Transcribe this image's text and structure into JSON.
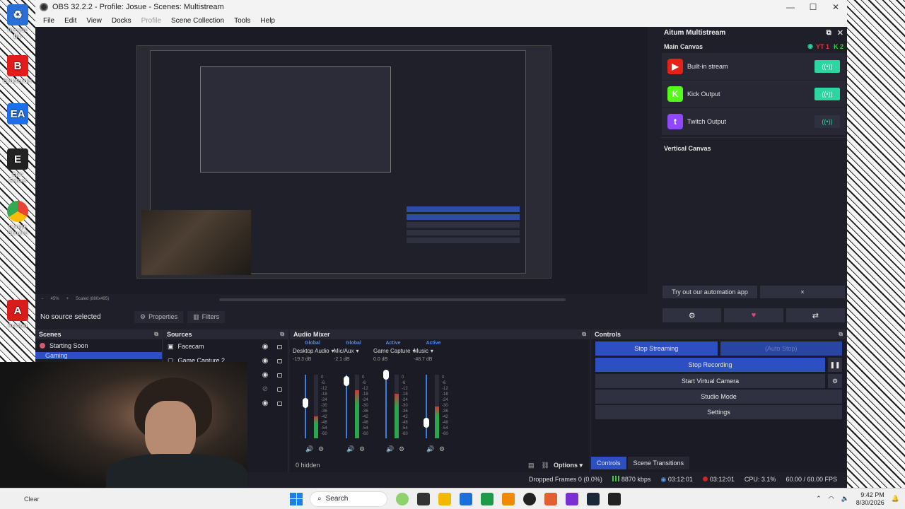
{
  "window": {
    "title": "OBS 32.2.2 - Profile: Josue - Scenes: Multistream",
    "menu": [
      "File",
      "Edit",
      "View",
      "Docks",
      "Profile",
      "Scene Collection",
      "Tools",
      "Help"
    ]
  },
  "desktop_icons": [
    "Recycle Bin",
    "Bitdefender",
    "EA",
    "Epic Games",
    "Google Chrome",
    "Acrobat"
  ],
  "preview": {
    "zoom_label": "45%",
    "scaled_label": "Scaled (880x495)"
  },
  "source_toolbar": {
    "status": "No source selected",
    "properties": "Properties",
    "filters": "Filters"
  },
  "multistream": {
    "title": "Aitum Multistream",
    "main_canvas": "Main Canvas",
    "yt_tag": "YT 1",
    "k_tag": "K 2",
    "outputs": [
      {
        "name": "Built-in stream",
        "state": "on",
        "color": "#e62117",
        "glyph": "▶"
      },
      {
        "name": "Kick Output",
        "state": "on",
        "color": "#53fc18",
        "glyph": "K"
      },
      {
        "name": "Twitch Output",
        "state": "off",
        "color": "#9146ff",
        "glyph": "t"
      }
    ],
    "vertical_canvas": "Vertical Canvas",
    "automation": "Try out our automation app",
    "close_symbol": "×"
  },
  "scenes": {
    "title": "Scenes",
    "items": [
      "Starting Soon",
      "Gaming"
    ]
  },
  "sources": {
    "title": "Sources",
    "items": [
      "Facecam",
      "Game Capture 2"
    ]
  },
  "mixer": {
    "title": "Audio Mixer",
    "channels": [
      {
        "tag": "Global",
        "name": "Desktop Audio",
        "db": "-19.3 dB",
        "level": 0.35,
        "vol": 0.55
      },
      {
        "tag": "Global",
        "name": "Mic/Aux",
        "db": "-2.1 dB",
        "level": 0.75,
        "vol": 0.9
      },
      {
        "tag": "Active",
        "name": "Game Capture",
        "db": "0.0 dB",
        "level": 0.7,
        "vol": 1.0
      },
      {
        "tag": "Active",
        "name": "Music",
        "db": "-48.7 dB",
        "level": 0.5,
        "vol": 0.25
      }
    ],
    "scale": [
      "0",
      "-6",
      "-12",
      "-18",
      "-24",
      "-30",
      "-36",
      "-42",
      "-48",
      "-54",
      "-60"
    ],
    "hidden": "0 hidden",
    "options": "Options"
  },
  "controls": {
    "title": "Controls",
    "stop_streaming": "Stop Streaming",
    "auto_stop": "(Auto Stop)",
    "stop_recording": "Stop Recording",
    "start_virtual_camera": "Start Virtual Camera",
    "studio_mode": "Studio Mode",
    "settings": "Settings",
    "tab_controls": "Controls",
    "tab_transitions": "Scene Transitions"
  },
  "stats": {
    "dropped": "Dropped Frames 0 (0.0%)",
    "bitrate": "8870 kbps",
    "stream_time": "03:12:01",
    "rec_time": "03:12:01",
    "cpu": "CPU: 3.1%",
    "fps": "60.00 / 60.00 FPS"
  },
  "taskbar": {
    "weather": "Clear",
    "search": "Search",
    "time": "9:42 PM",
    "date": "8/30/2026"
  },
  "colors": {
    "accent": "#2c50c4",
    "toggle_on": "#2bd6a0",
    "panel": "#1e1f29"
  }
}
